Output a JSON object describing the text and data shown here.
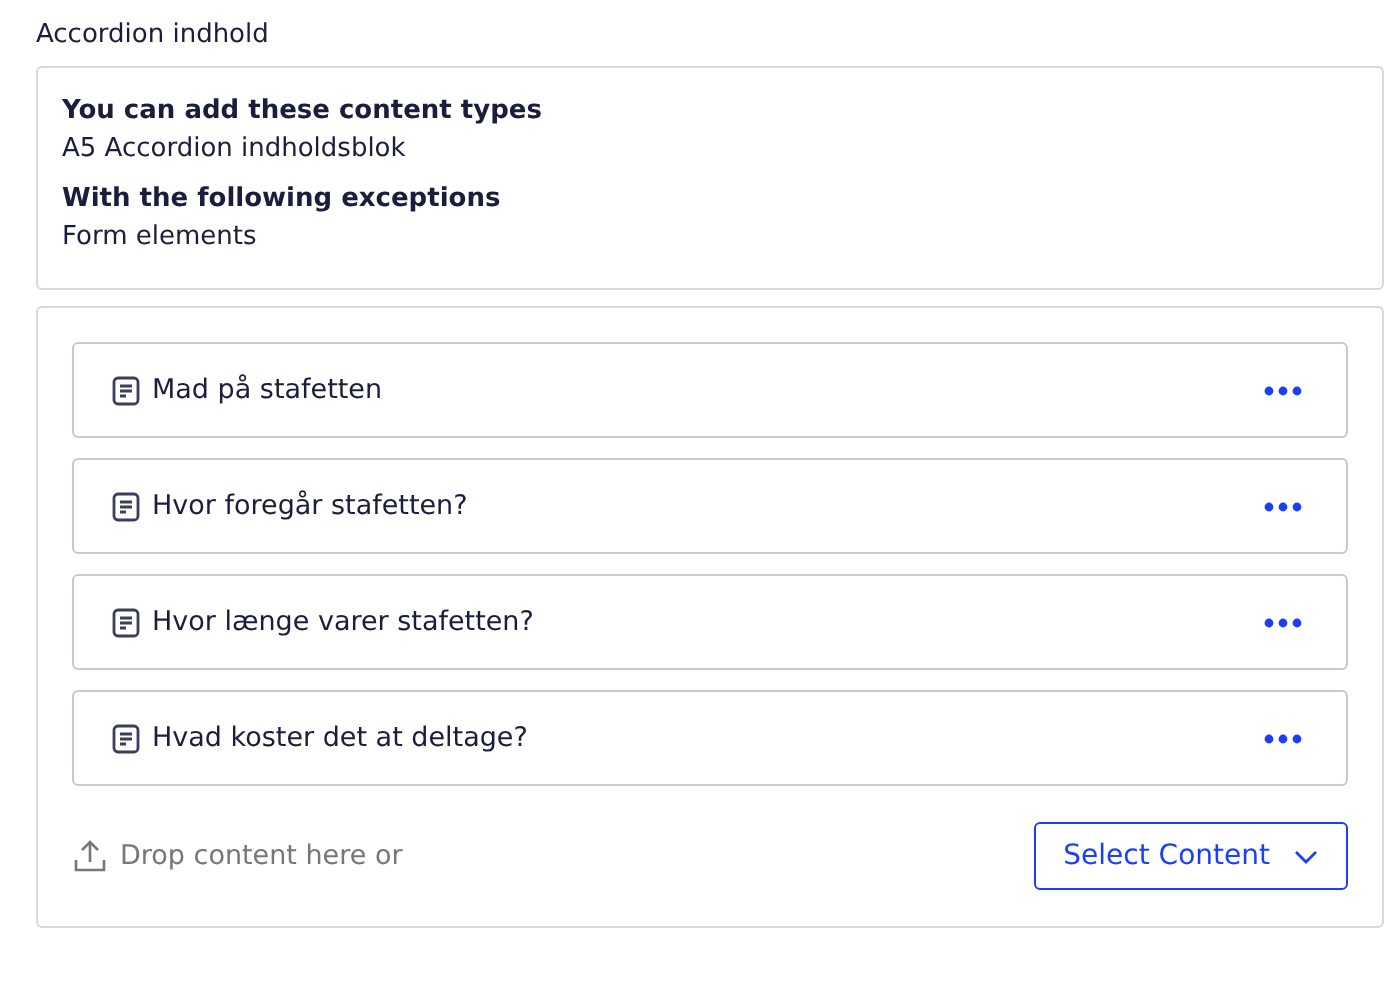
{
  "field_label": "Accordion indhold",
  "allowed": {
    "heading": "You can add these content types",
    "types": "A5 Accordion indholdsblok",
    "exceptions_heading": "With the following exceptions",
    "exceptions": "Form elements"
  },
  "items": [
    {
      "title": "Mad på stafetten"
    },
    {
      "title": "Hvor foregår stafetten?"
    },
    {
      "title": "Hvor længe varer stafetten?"
    },
    {
      "title": "Hvad koster det at deltage?"
    }
  ],
  "drop_hint": "Drop content here or",
  "select_button": "Select Content"
}
